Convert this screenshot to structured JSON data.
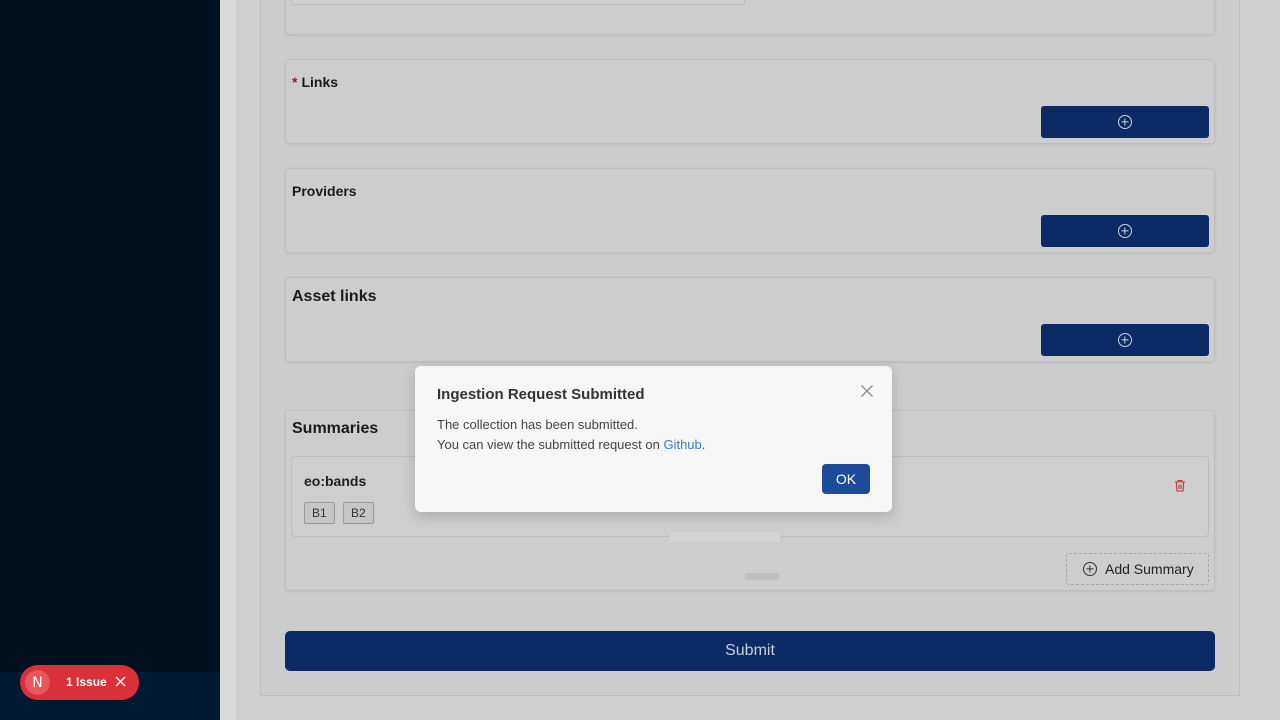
{
  "links_section": {
    "title": "Links",
    "required_marker": "*"
  },
  "providers_section": {
    "title": "Providers"
  },
  "asset_links_section": {
    "title": "Asset links"
  },
  "summaries_section": {
    "title": "Summaries",
    "items": [
      {
        "name": "eo:bands",
        "tags": [
          "B1",
          "B2"
        ]
      }
    ],
    "add_label": "Add Summary"
  },
  "submit_label": "Submit",
  "modal": {
    "title": "Ingestion Request Submitted",
    "line1": "The collection has been submitted.",
    "line2_prefix": "You can view the submitted request on ",
    "link_text": "Github",
    "line2_suffix": ".",
    "ok_label": "OK"
  },
  "dev_badge": {
    "logo": "N",
    "label": "1 Issue"
  },
  "colors": {
    "primary": "#0b2a66",
    "modal_ok": "#1d4b9a",
    "link": "#2f7fd1",
    "badge": "#d8313a",
    "required": "#a61b1b"
  }
}
